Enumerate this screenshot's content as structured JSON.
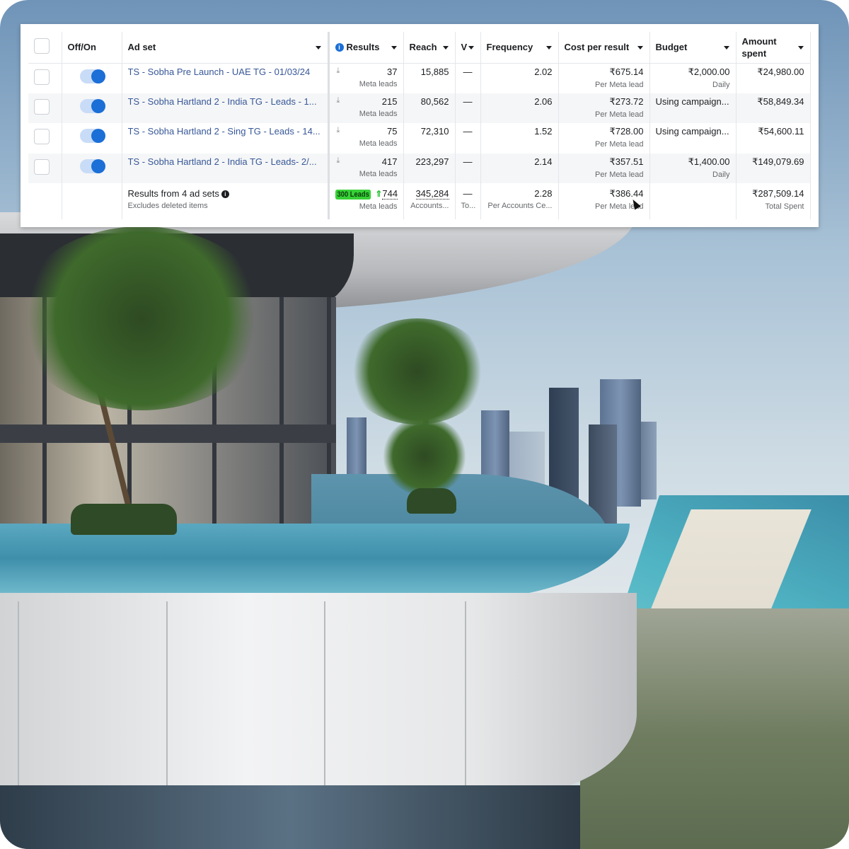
{
  "table": {
    "headers": {
      "offon": "Off/On",
      "adset": "Ad set",
      "results": "Results",
      "reach": "Reach",
      "v": "V",
      "frequency": "Frequency",
      "cost": "Cost per result",
      "budget": "Budget",
      "amount": "Amount spent"
    },
    "rows": [
      {
        "name": "TS - Sobha Pre Launch - UAE TG - 01/03/24",
        "results": "37",
        "results_sub": "Meta leads",
        "reach": "15,885",
        "v": "—",
        "frequency": "2.02",
        "cost": "₹675.14",
        "cost_sub": "Per Meta lead",
        "budget": "₹2,000.00",
        "budget_sub": "Daily",
        "amount": "₹24,980.00",
        "toggle_on": true
      },
      {
        "name": "TS - Sobha Hartland 2 - India TG - Leads - 1...",
        "results": "215",
        "results_sub": "Meta leads",
        "reach": "80,562",
        "v": "—",
        "frequency": "2.06",
        "cost": "₹273.72",
        "cost_sub": "Per Meta lead",
        "budget": "Using campaign...",
        "budget_sub": "",
        "amount": "₹58,849.34",
        "toggle_on": true
      },
      {
        "name": "TS - Sobha Hartland 2 - Sing TG - Leads - 14...",
        "results": "75",
        "results_sub": "Meta leads",
        "reach": "72,310",
        "v": "—",
        "frequency": "1.52",
        "cost": "₹728.00",
        "cost_sub": "Per Meta lead",
        "budget": "Using campaign...",
        "budget_sub": "",
        "amount": "₹54,600.11",
        "toggle_on": true
      },
      {
        "name": "TS - Sobha Hartland 2 - India TG - Leads- 2/...",
        "results": "417",
        "results_sub": "Meta leads",
        "reach": "223,297",
        "v": "—",
        "frequency": "2.14",
        "cost": "₹357.51",
        "cost_sub": "Per Meta lead",
        "budget": "₹1,400.00",
        "budget_sub": "Daily",
        "amount": "₹149,079.69",
        "toggle_on": true
      }
    ],
    "total": {
      "label": "Results from 4 ad sets",
      "sub": "Excludes deleted items",
      "badge": "300 Leads",
      "results": "744",
      "results_sub": "Meta leads",
      "reach": "345,284",
      "reach_sub": "Accounts...",
      "v": "—",
      "v_sub": "To...",
      "frequency": "2.28",
      "frequency_sub": "Per Accounts Ce...",
      "cost": "₹386.44",
      "cost_sub": "Per Meta lead",
      "amount": "₹287,509.14",
      "amount_sub": "Total Spent"
    }
  },
  "icons": {
    "download": "⤓",
    "info": "i",
    "up_arrow": "⇑"
  },
  "colors": {
    "link": "#385898",
    "toggle_on": "#1b6fd6",
    "badge_green": "#36d136"
  }
}
